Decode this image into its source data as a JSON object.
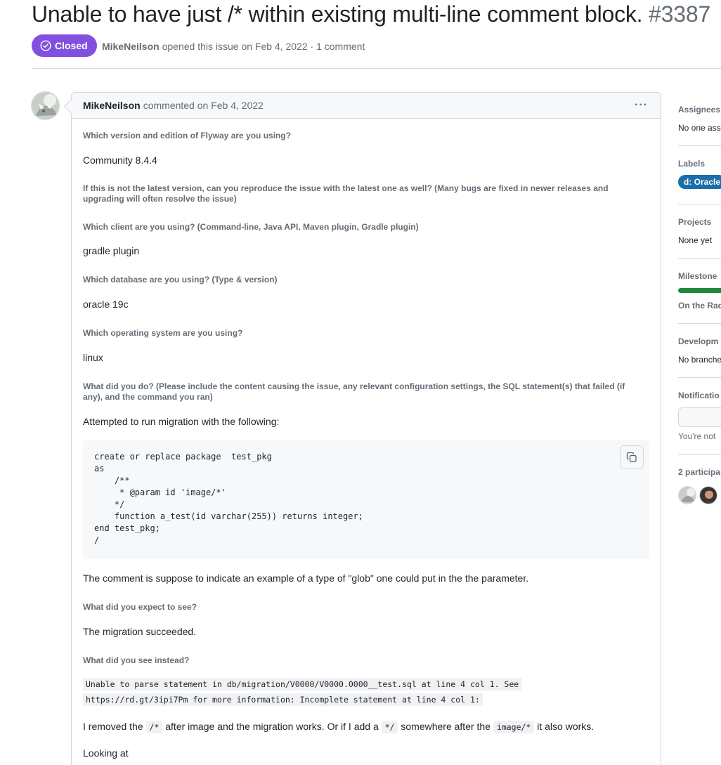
{
  "issue": {
    "title": "Unable to have just /* within existing multi-line comment block.",
    "number": "#3387",
    "state": "Closed",
    "author": "MikeNeilson",
    "opened_text": "opened this issue on Feb 4, 2022 · 1 comment"
  },
  "comment": {
    "author": "MikeNeilson",
    "date_text": "commented on Feb 4, 2022",
    "menu_glyph": "···",
    "q_version": "Which version and edition of Flyway are you using?",
    "a_version": "Community 8.4.4",
    "q_latest": "If this is not the latest version, can you reproduce the issue with the latest one as well? (Many bugs are fixed in newer releases and upgrading will often resolve the issue)",
    "q_client": "Which client are you using? (Command-line, Java API, Maven plugin, Gradle plugin)",
    "a_client": "gradle plugin",
    "q_db": "Which database are you using? (Type & version)",
    "a_db": "oracle 19c",
    "q_os": "Which operating system are you using?",
    "a_os": "linux",
    "q_do": "What did you do? (Please include the content causing the issue, any relevant configuration settings, the SQL statement(s) that failed (if any), and the command you ran)",
    "a_do": "Attempted to run migration with the following:",
    "code": "create or replace package  test_pkg\nas\n    /**\n     * @param id 'image/*'\n    */\n    function a_test(id varchar(255)) returns integer;\nend test_pkg;\n/",
    "comment_note": "The comment is suppose to indicate an example of a type of \"glob\" one could put in the the parameter.",
    "q_expect": "What did you expect to see?",
    "a_expect": "The migration succeeded.",
    "q_instead": "What did you see instead?",
    "err_line1": "Unable to parse statement in db/migration/V0000/V0000.0000__test.sql at line 4 col 1. See",
    "err_line2": "https://rd.gt/3ipi7Pm for more information: Incomplete statement at line 4 col 1:",
    "removed_1": "I removed the",
    "removed_code1": "/*",
    "removed_2": "after image and the migration works. Or if I add a",
    "removed_code2": "*/",
    "removed_3": "somewhere after the",
    "removed_code3": "image/*",
    "removed_4": "it also works.",
    "looking": "Looking at"
  },
  "sidebar": {
    "assignees_label": "Assignees",
    "assignees_value": "No one ass",
    "labels_label": "Labels",
    "label_pill": "d: Oracle",
    "projects_label": "Projects",
    "projects_value": "None yet",
    "milestone_label": "Milestone",
    "milestone_value": "On the Rad",
    "milestone_progress": 1.0,
    "development_label": "Developm",
    "development_value": "No branche",
    "notifications_label": "Notificatio",
    "notifications_value": "You're not",
    "participants_label": "2 participa"
  },
  "colors": {
    "closed_badge": "#8250df",
    "label_oracle": "#1b6ea8",
    "milestone_bar": "#1f883d"
  }
}
